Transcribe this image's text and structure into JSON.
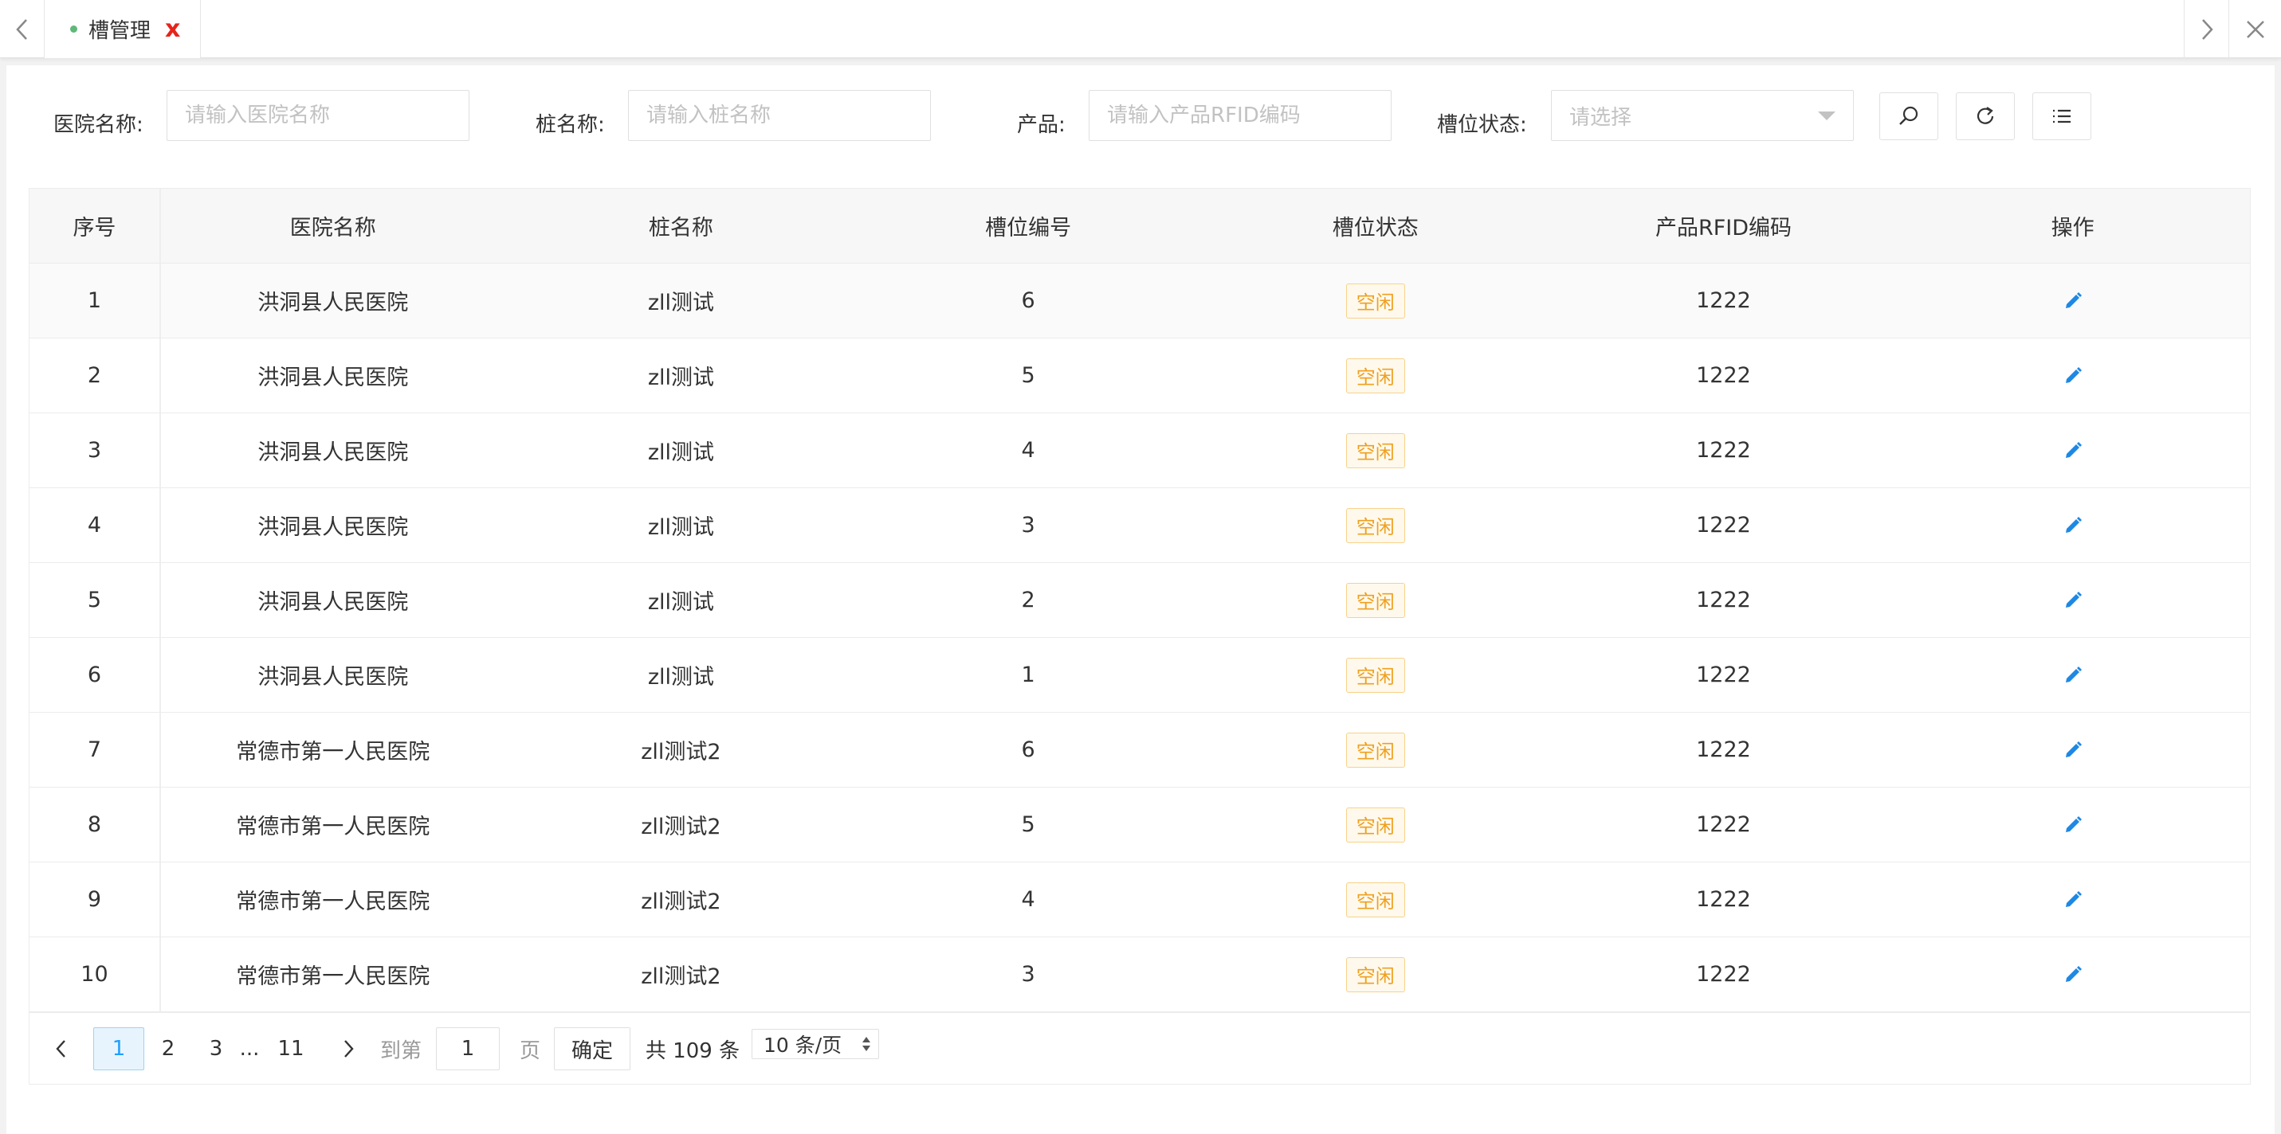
{
  "tabbar": {
    "prev_icon": "chevron-left-icon",
    "next_icon": "chevron-right-icon",
    "close_all_icon": "close-icon",
    "tabs": [
      {
        "label": "槽管理",
        "close": "x"
      }
    ]
  },
  "search": {
    "hospital_label": "医院名称:",
    "hospital_placeholder": "请输入医院名称",
    "pile_label": "桩名称:",
    "pile_placeholder": "请输入桩名称",
    "product_label": "产品:",
    "product_placeholder": "请输入产品RFID编码",
    "status_label": "槽位状态:",
    "status_placeholder": "请选择",
    "search_icon": "search-icon",
    "reset_icon": "refresh-icon",
    "columns_icon": "list-icon"
  },
  "table": {
    "columns": [
      "序号",
      "医院名称",
      "桩名称",
      "槽位编号",
      "槽位状态",
      "产品RFID编码",
      "操作"
    ],
    "rows": [
      {
        "no": "1",
        "hospital": "洪洞县人民医院",
        "pile": "zll测试",
        "slot": "6",
        "status": "空闲",
        "rfid": "1222"
      },
      {
        "no": "2",
        "hospital": "洪洞县人民医院",
        "pile": "zll测试",
        "slot": "5",
        "status": "空闲",
        "rfid": "1222"
      },
      {
        "no": "3",
        "hospital": "洪洞县人民医院",
        "pile": "zll测试",
        "slot": "4",
        "status": "空闲",
        "rfid": "1222"
      },
      {
        "no": "4",
        "hospital": "洪洞县人民医院",
        "pile": "zll测试",
        "slot": "3",
        "status": "空闲",
        "rfid": "1222"
      },
      {
        "no": "5",
        "hospital": "洪洞县人民医院",
        "pile": "zll测试",
        "slot": "2",
        "status": "空闲",
        "rfid": "1222"
      },
      {
        "no": "6",
        "hospital": "洪洞县人民医院",
        "pile": "zll测试",
        "slot": "1",
        "status": "空闲",
        "rfid": "1222"
      },
      {
        "no": "7",
        "hospital": "常德市第一人民医院",
        "pile": "zll测试2",
        "slot": "6",
        "status": "空闲",
        "rfid": "1222"
      },
      {
        "no": "8",
        "hospital": "常德市第一人民医院",
        "pile": "zll测试2",
        "slot": "5",
        "status": "空闲",
        "rfid": "1222"
      },
      {
        "no": "9",
        "hospital": "常德市第一人民医院",
        "pile": "zll测试2",
        "slot": "4",
        "status": "空闲",
        "rfid": "1222"
      },
      {
        "no": "10",
        "hospital": "常德市第一人民医院",
        "pile": "zll测试2",
        "slot": "3",
        "status": "空闲",
        "rfid": "1222"
      }
    ],
    "action_icon": "edit-icon",
    "status_color": "#f0a020"
  },
  "pager": {
    "prev_icon": "chevron-left-icon",
    "pages": [
      "1",
      "2",
      "3"
    ],
    "ellipsis": "...",
    "last_page": "11",
    "next_icon": "chevron-right-icon",
    "goto_label": "到第",
    "goto_value": "1",
    "page_unit": "页",
    "confirm": "确定",
    "total": "共 109 条",
    "page_size": "10 条/页"
  },
  "colors": {
    "accent": "#1e9fff",
    "tab_dot": "#5fb878",
    "tab_close": "#e5251c",
    "badge_border": "#f8d28a"
  }
}
